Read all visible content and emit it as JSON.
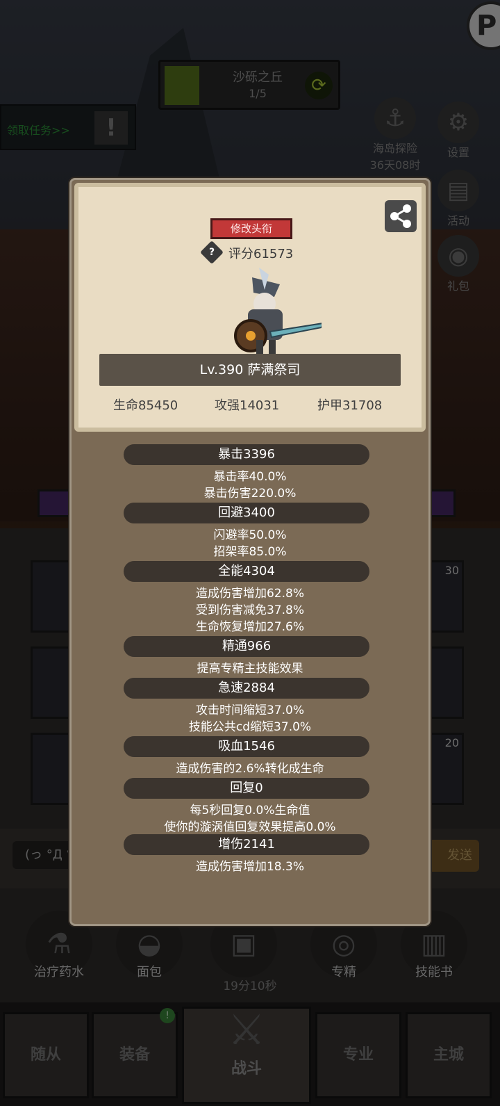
{
  "stage": {
    "name": "沙砾之丘",
    "progress": "1/5"
  },
  "quest": {
    "label": "领取任务>>"
  },
  "side_icons": [
    {
      "label": "海岛探险",
      "sub": "36天08时"
    },
    {
      "label": "设置"
    },
    {
      "label": "活动"
    },
    {
      "label": "礼包"
    }
  ],
  "slots": [
    {
      "count": "30"
    },
    {
      "count": "20"
    }
  ],
  "chat": {
    "input_text": "(っ °Д °",
    "send_label": "发送"
  },
  "items": [
    {
      "label": "治疗药水"
    },
    {
      "label": "面包"
    },
    {
      "label": "专精"
    },
    {
      "label": "技能书"
    }
  ],
  "timer": "19分10秒",
  "nav": [
    {
      "label": "随从"
    },
    {
      "label": "装备",
      "badge": "!"
    },
    {
      "label": "战斗"
    },
    {
      "label": "专业"
    },
    {
      "label": "主城"
    }
  ],
  "character": {
    "rename_label": "修改头衔",
    "score": "评分61573",
    "name": "Lv.390 萨满祭司",
    "hp": "生命85450",
    "attack": "攻强14031",
    "armor": "护甲31708"
  },
  "stats": [
    {
      "head": "暴击3396",
      "lines": [
        "暴击率40.0%",
        "暴击伤害220.0%"
      ]
    },
    {
      "head": "回避3400",
      "lines": [
        "闪避率50.0%",
        "招架率85.0%"
      ]
    },
    {
      "head": "全能4304",
      "lines": [
        "造成伤害增加62.8%",
        "受到伤害减免37.8%",
        "生命恢复增加27.6%"
      ]
    },
    {
      "head": "精通966",
      "lines": [
        "提高专精主技能效果"
      ]
    },
    {
      "head": "急速2884",
      "lines": [
        "攻击时间缩短37.0%",
        "技能公共cd缩短37.0%"
      ]
    },
    {
      "head": "吸血1546",
      "lines": [
        "造成伤害的2.6%转化成生命"
      ]
    },
    {
      "head": "回复0",
      "lines": [
        "每5秒回复0.0%生命值",
        "使你的漩涡值回复效果提高0.0%"
      ]
    },
    {
      "head": "增伤2141",
      "lines": [
        "造成伤害增加18.3%"
      ]
    }
  ]
}
